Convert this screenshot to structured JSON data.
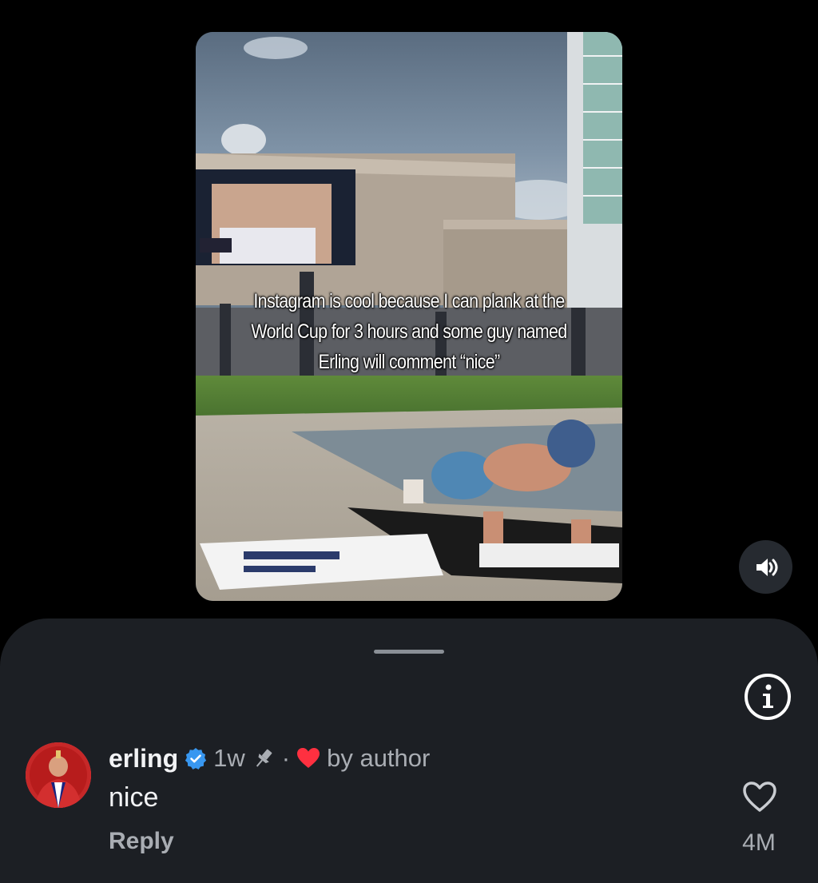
{
  "video": {
    "caption": "Instagram is cool because I can plank at the World Cup for 3 hours and some guy named Erling will comment “nice”"
  },
  "controls": {
    "sound_icon": "speaker-volume-icon",
    "info_icon": "info-icon"
  },
  "comment": {
    "username": "erling",
    "verified_icon": "verified-badge-icon",
    "time": "1w",
    "pin_icon": "pin-icon",
    "separator": "·",
    "heart_icon": "heart-filled-icon",
    "by_author": "by author",
    "text": "nice",
    "reply_label": "Reply",
    "like_icon": "heart-outline-icon",
    "like_count": "4M"
  },
  "colors": {
    "sheet_bg": "#1c1f24",
    "verified": "#3897f0",
    "author_heart": "#ff3040"
  }
}
